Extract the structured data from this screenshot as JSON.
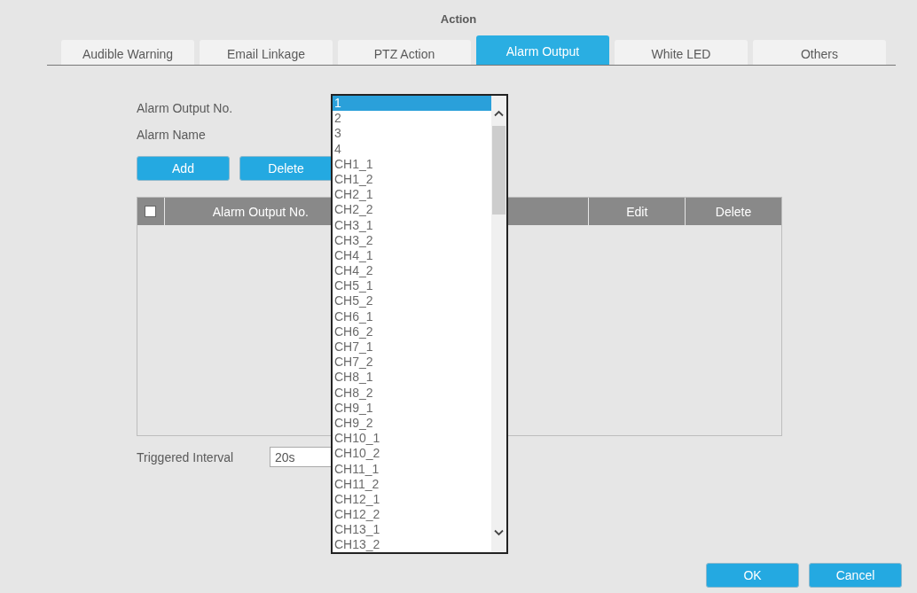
{
  "title": "Action",
  "tabs": [
    {
      "label": "Audible Warning",
      "selected": false
    },
    {
      "label": "Email Linkage",
      "selected": false
    },
    {
      "label": "PTZ Action",
      "selected": false
    },
    {
      "label": "Alarm Output",
      "selected": true
    },
    {
      "label": "White LED",
      "selected": false
    },
    {
      "label": "Others",
      "selected": false
    }
  ],
  "fields": [
    {
      "label": "Alarm Output No."
    },
    {
      "label": "Alarm Name"
    }
  ],
  "buttons": [
    "Add",
    "Delete"
  ],
  "table": {
    "columns": [
      {
        "kind": "checkbox",
        "checked": false
      },
      {
        "kind": "text",
        "label": "Alarm Output No."
      },
      {
        "kind": "covered"
      },
      {
        "kind": "text",
        "label": "Edit"
      },
      {
        "kind": "text",
        "label": "Delete"
      }
    ]
  },
  "interval": {
    "label": "Triggered Interval",
    "value": "20s"
  },
  "dropdown": {
    "options": [
      {
        "label": "1",
        "selected": true
      },
      {
        "label": "2",
        "selected": false
      },
      {
        "label": "3",
        "selected": false
      },
      {
        "label": "4",
        "selected": false
      },
      {
        "label": "CH1_1",
        "selected": false
      },
      {
        "label": "CH1_2",
        "selected": false
      },
      {
        "label": "CH2_1",
        "selected": false
      },
      {
        "label": "CH2_2",
        "selected": false
      },
      {
        "label": "CH3_1",
        "selected": false
      },
      {
        "label": "CH3_2",
        "selected": false
      },
      {
        "label": "CH4_1",
        "selected": false
      },
      {
        "label": "CH4_2",
        "selected": false
      },
      {
        "label": "CH5_1",
        "selected": false
      },
      {
        "label": "CH5_2",
        "selected": false
      },
      {
        "label": "CH6_1",
        "selected": false
      },
      {
        "label": "CH6_2",
        "selected": false
      },
      {
        "label": "CH7_1",
        "selected": false
      },
      {
        "label": "CH7_2",
        "selected": false
      },
      {
        "label": "CH8_1",
        "selected": false
      },
      {
        "label": "CH8_2",
        "selected": false
      },
      {
        "label": "CH9_1",
        "selected": false
      },
      {
        "label": "CH9_2",
        "selected": false
      },
      {
        "label": "CH10_1",
        "selected": false
      },
      {
        "label": "CH10_2",
        "selected": false
      },
      {
        "label": "CH11_1",
        "selected": false
      },
      {
        "label": "CH11_2",
        "selected": false
      },
      {
        "label": "CH12_1",
        "selected": false
      },
      {
        "label": "CH12_2",
        "selected": false
      },
      {
        "label": "CH13_1",
        "selected": false
      },
      {
        "label": "CH13_2",
        "selected": false
      }
    ]
  },
  "footer_buttons": [
    "OK",
    "Cancel"
  ]
}
